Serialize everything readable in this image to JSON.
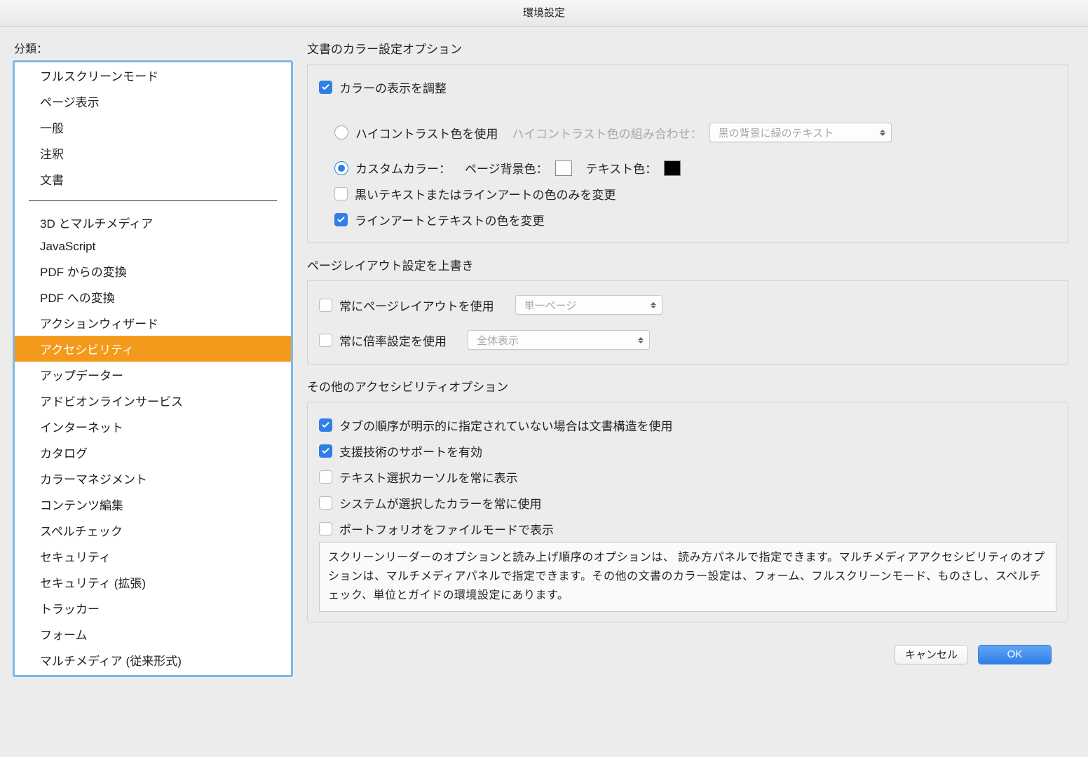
{
  "window": {
    "title": "環境設定"
  },
  "sidebar": {
    "label": "分類：",
    "group1": [
      "フルスクリーンモード",
      "ページ表示",
      "一般",
      "注釈",
      "文書"
    ],
    "group2": [
      "3D とマルチメディア",
      "JavaScript",
      "PDF からの変換",
      "PDF への変換",
      "アクションウィザード",
      "アクセシビリティ",
      "アップデーター",
      "アドビオンラインサービス",
      "インターネット",
      "カタログ",
      "カラーマネジメント",
      "コンテンツ編集",
      "スペルチェック",
      "セキュリティ",
      "セキュリティ (拡張)",
      "トラッカー",
      "フォーム",
      "マルチメディア (従来形式)"
    ],
    "selected": "アクセシビリティ"
  },
  "sections": {
    "colors": {
      "title": "文書のカラー設定オプション",
      "adjust": "カラーの表示を調整",
      "high_contrast": "ハイコントラスト色を使用",
      "high_contrast_combo_label": "ハイコントラスト色の組み合わせ：",
      "high_contrast_combo_value": "黒の背景に緑のテキスト",
      "custom": "カスタムカラー：",
      "page_bg_label": "ページ背景色：",
      "text_color_label": "テキスト色：",
      "page_bg_value": "#ffffff",
      "text_color_value": "#000000",
      "only_black": "黒いテキストまたはラインアートの色のみを変更",
      "lineart": "ラインアートとテキストの色を変更"
    },
    "layout": {
      "title": "ページレイアウト設定を上書き",
      "always_layout": "常にページレイアウトを使用",
      "layout_value": "単一ページ",
      "always_zoom": "常に倍率設定を使用",
      "zoom_value": "全体表示"
    },
    "other": {
      "title": "その他のアクセシビリティオプション",
      "tab_order": "タブの順序が明示的に指定されていない場合は文書構造を使用",
      "assistive": "支援技術のサポートを有効",
      "text_cursor": "テキスト選択カーソルを常に表示",
      "system_colors": "システムが選択したカラーを常に使用",
      "portfolio": "ポートフォリオをファイルモードで表示"
    },
    "info": "スクリーンリーダーのオプションと読み上げ順序のオプションは、 読み方パネルで指定できます。マルチメディアアクセシビリティのオプションは、マルチメディアパネルで指定できます。その他の文書のカラー設定は、フォーム、フルスクリーンモード、ものさし、スペルチェック、単位とガイドの環境設定にあります。"
  },
  "buttons": {
    "cancel": "キャンセル",
    "ok": "OK"
  }
}
